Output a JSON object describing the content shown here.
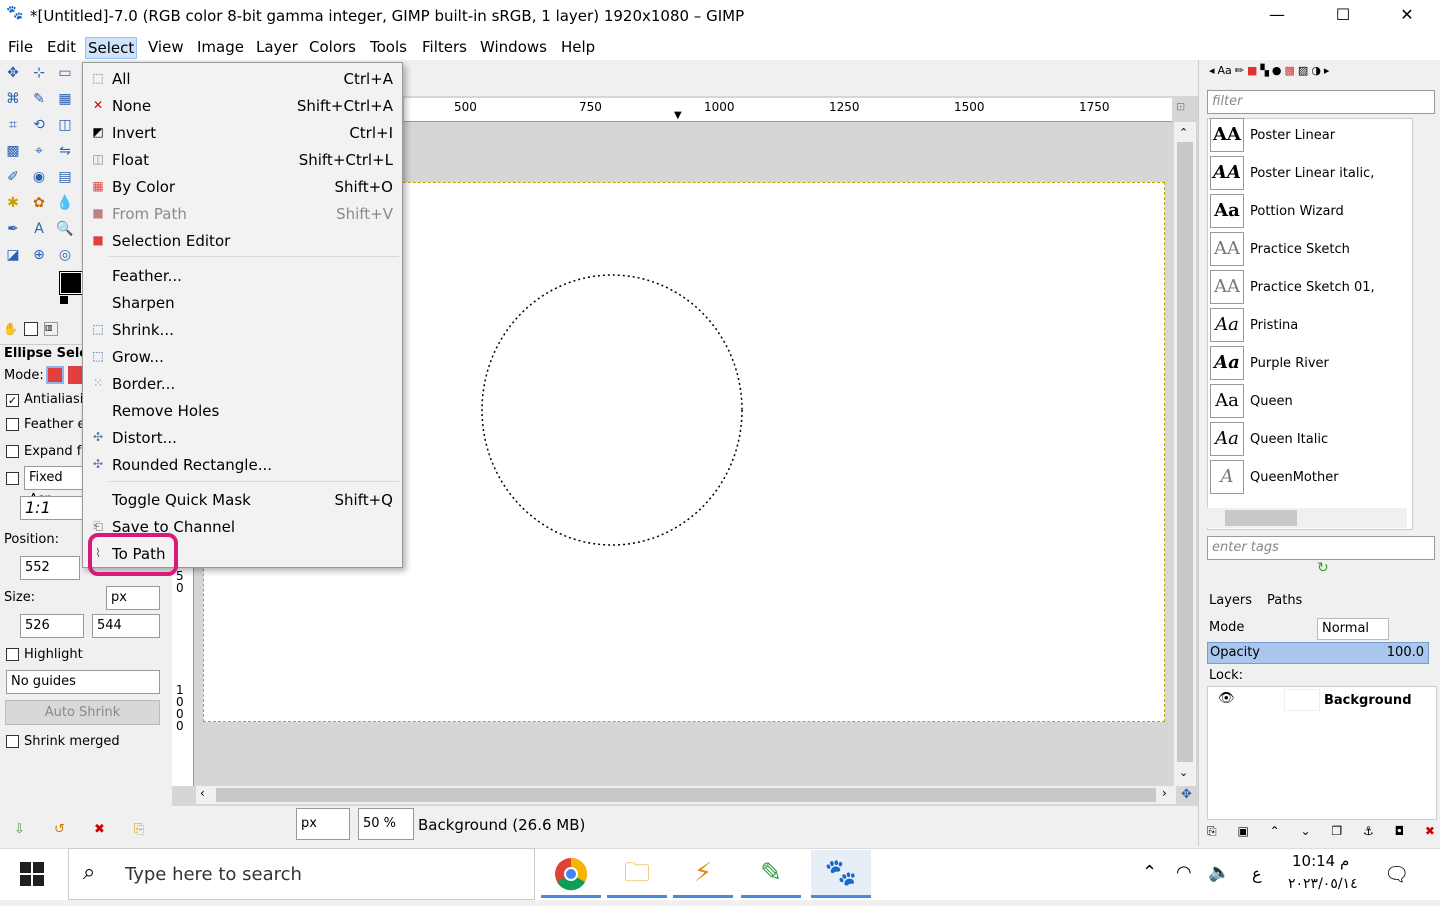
{
  "window": {
    "title": "*[Untitled]-7.0 (RGB color 8-bit gamma integer, GIMP built-in sRGB, 1 layer) 1920x1080 – GIMP",
    "minimize": "—",
    "maximize": "☐",
    "close": "✕"
  },
  "menubar": [
    "File",
    "Edit",
    "Select",
    "View",
    "Image",
    "Layer",
    "Colors",
    "Tools",
    "Filters",
    "Windows",
    "Help"
  ],
  "select_menu": {
    "items": [
      {
        "label": "All",
        "accel": "Ctrl+A",
        "icon": "select-all-icon",
        "disabled": false
      },
      {
        "label": "None",
        "accel": "Shift+Ctrl+A",
        "icon": "select-none-icon",
        "disabled": false
      },
      {
        "label": "Invert",
        "accel": "Ctrl+I",
        "icon": "invert-icon",
        "disabled": false
      },
      {
        "label": "Float",
        "accel": "Shift+Ctrl+L",
        "icon": "float-icon",
        "disabled": true
      },
      {
        "label": "By Color",
        "accel": "Shift+O",
        "icon": "by-color-icon",
        "disabled": false
      },
      {
        "label": "From Path",
        "accel": "Shift+V",
        "icon": "from-path-icon",
        "disabled": true
      },
      {
        "label": "Selection Editor",
        "accel": "",
        "icon": "selection-editor-icon",
        "disabled": false
      },
      {
        "label": "Feather...",
        "accel": "",
        "icon": "",
        "disabled": false
      },
      {
        "label": "Sharpen",
        "accel": "",
        "icon": "",
        "disabled": false
      },
      {
        "label": "Shrink...",
        "accel": "",
        "icon": "shrink-icon",
        "disabled": false
      },
      {
        "label": "Grow...",
        "accel": "",
        "icon": "grow-icon",
        "disabled": false
      },
      {
        "label": "Border...",
        "accel": "",
        "icon": "border-icon",
        "disabled": false
      },
      {
        "label": "Remove Holes",
        "accel": "",
        "icon": "",
        "disabled": false
      },
      {
        "label": "Distort...",
        "accel": "",
        "icon": "distort-icon",
        "disabled": false
      },
      {
        "label": "Rounded Rectangle...",
        "accel": "",
        "icon": "rounded-rect-icon",
        "disabled": false
      },
      {
        "label": "Toggle Quick Mask",
        "accel": "Shift+Q",
        "icon": "",
        "disabled": false
      },
      {
        "label": "Save to Channel",
        "accel": "",
        "icon": "save-channel-icon",
        "disabled": false
      },
      {
        "label": "To Path",
        "accel": "",
        "icon": "to-path-icon",
        "disabled": false
      }
    ]
  },
  "tool_options": {
    "title": "Ellipse Selec",
    "mode_label": "Mode:",
    "antialiasing": "Antialiasir",
    "feather": "Feather e",
    "expand": "Expand fr",
    "fixed": "Fixed Asp",
    "ratio": "1:1",
    "position_label": "Position:",
    "position_x": "552",
    "size_label": "Size:",
    "size_unit": "px",
    "size_w": "526",
    "size_h": "544",
    "highlight": "Highlight",
    "guides": "No guides",
    "auto_shrink": "Auto Shrink",
    "shrink_merged": "Shrink merged"
  },
  "ruler": {
    "top_labels": [
      "500",
      "750",
      "1000",
      "1250",
      "1500",
      "1750"
    ],
    "left_labels_a": [
      "5",
      "0"
    ],
    "left_labels_b": [
      "1",
      "0",
      "0",
      "0"
    ]
  },
  "status": {
    "unit": "px",
    "zoom": "50 %",
    "info": "Background (26.6 MB)"
  },
  "fonts_panel": {
    "filter_placeholder": "filter",
    "tags_placeholder": "enter tags",
    "fonts": [
      {
        "name": "Poster Linear",
        "preview": "AA"
      },
      {
        "name": "Poster Linear italic,",
        "preview": "AA"
      },
      {
        "name": "Pottion Wizard",
        "preview": "Aa"
      },
      {
        "name": "Practice Sketch",
        "preview": "AA"
      },
      {
        "name": "Practice Sketch 01,",
        "preview": "AA"
      },
      {
        "name": "Pristina",
        "preview": "Aa"
      },
      {
        "name": "Purple River",
        "preview": "Aa"
      },
      {
        "name": "Queen",
        "preview": "Aa"
      },
      {
        "name": "Queen Italic",
        "preview": "Aa"
      },
      {
        "name": "QueenMother",
        "preview": "A"
      }
    ]
  },
  "layers_panel": {
    "tab_layers": "Layers",
    "tab_paths": "Paths",
    "mode_label": "Mode",
    "mode_value": "Normal",
    "opacity_label": "Opacity",
    "opacity_value": "100.0",
    "lock_label": "Lock:",
    "layer_name": "Background"
  },
  "taskbar": {
    "search_placeholder": "Type here to search",
    "time": "10:14 م",
    "date": "٢٠٢٣/٠٥/١٤",
    "lang": "ع"
  },
  "colors": {
    "menu_highlight": "#cfe3fb",
    "annotation": "#d81b7a",
    "accent": "#4a8be0"
  }
}
